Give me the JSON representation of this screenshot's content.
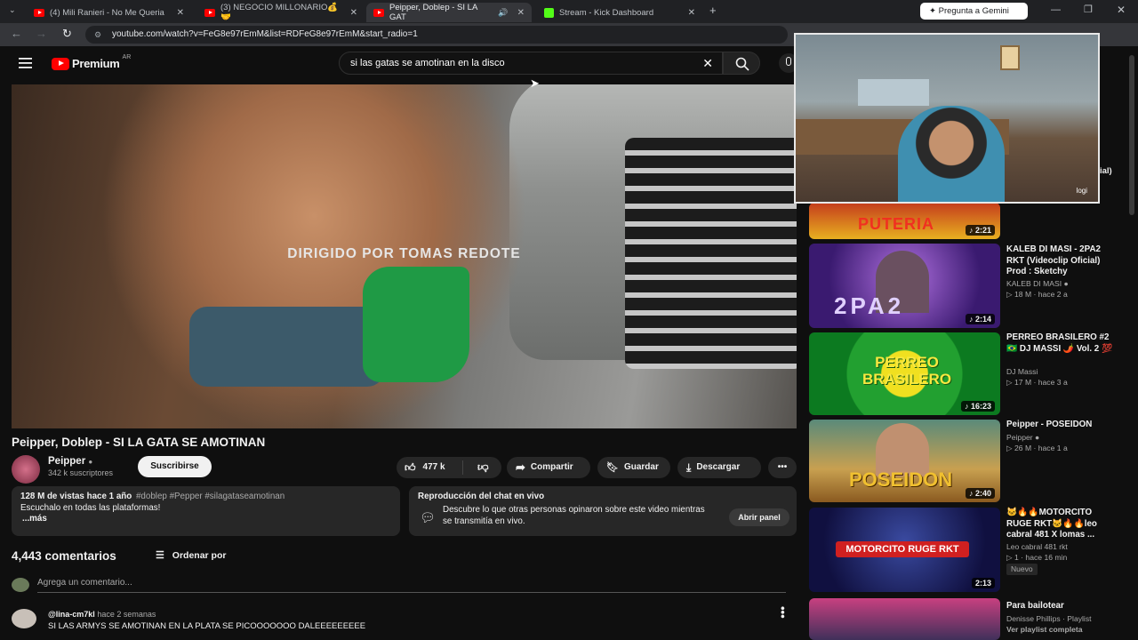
{
  "browser": {
    "tabs": [
      {
        "label": "(4) Mili Ranieri - No Me Queria",
        "icon": "youtube-icon"
      },
      {
        "label": "(3) NEGOCIO MILLONARIO💰🤝",
        "icon": "youtube-icon"
      },
      {
        "label": "Peipper, Doblep - SI LA GAT",
        "icon": "youtube-icon",
        "active": true
      },
      {
        "label": "Stream - Kick Dashboard",
        "icon": "kick-icon"
      }
    ],
    "gemini_button": "Pregunta a Gemini",
    "url": "youtube.com/watch?v=FeG8e97rEmM&list=RDFeG8e97rEmM&start_radio=1"
  },
  "youtube": {
    "logo": "Premium",
    "region": "AR",
    "search_value": "si las gatas se amotinan en la disco"
  },
  "video": {
    "caption": "DIRIGIDO POR TOMAS REDOTE",
    "title": "Peipper, Doblep - SI LA GATA SE AMOTINAN",
    "channel": "Peipper",
    "subscribers": "342 k suscriptores",
    "subscribe_label": "Suscribirse",
    "likes": "477 k",
    "share_label": "Compartir",
    "save_label": "Guardar",
    "download_label": "Descargar"
  },
  "description": {
    "stats": "128 M de vistas  hace 1 año",
    "tags": "#doblep #Pepper #silagataseamotinan",
    "text": "Escuchalo en todas las plataformas!",
    "more": "...más"
  },
  "chat_replay": {
    "title": "Reproducción del chat en vivo",
    "text": "Descubre lo que otras personas opinaron sobre este video mientras se transmitía en vivo.",
    "button": "Abrir panel"
  },
  "comments": {
    "count": "4,443 comentarios",
    "sort_label": "Ordenar por",
    "add_placeholder": "Agrega un comentario...",
    "first": {
      "author": "@lina-cm7kl",
      "time": "hace 2 semanas",
      "text": "SI LAS ARMYS SE AMOTINAN EN LA PLATA SE PICOOOOOOO DALEEEEEEEEE"
    }
  },
  "related": [
    {
      "thumb_text": "PUTERIA",
      "duration": "2:21"
    },
    {
      "title": "KALEB DI MASI - 2PA2 RKT (Videoclip Oficial) Prod : Sketchy",
      "channel": "KALEB DI MASI",
      "views": "18 M",
      "age": "hace 2 a",
      "duration": "2:14",
      "thumb_text": "2PA2"
    },
    {
      "title": "PERREO BRASILERO #2 🇧🇷 DJ MASSI 🌶️ Vol. 2 💯",
      "channel": "DJ Massi",
      "views": "17 M",
      "age": "hace 3 a",
      "duration": "16:23",
      "thumb_text": "PERREO BRASILERO"
    },
    {
      "title": "Peipper - POSEIDON",
      "channel": "Peipper",
      "views": "26 M",
      "age": "hace 1 a",
      "duration": "2:40",
      "thumb_text": "POSEIDON"
    },
    {
      "title": "🐱🔥🔥MOTORCITO RUGE RKT🐱🔥🔥leo cabral 481 X lomas ...",
      "channel": "Leo cabral 481 rkt",
      "views": "1",
      "age": "hace 16 min",
      "badge": "Nuevo",
      "duration": "2:13",
      "thumb_text": "MOTORCITO RUGE RKT"
    },
    {
      "title": "Para bailotear",
      "channel": "Denisse Phillips · Playlist",
      "extra": "Ver playlist completa"
    }
  ],
  "webcam": {
    "overlay_text": "logi",
    "side_text": "ial)"
  }
}
